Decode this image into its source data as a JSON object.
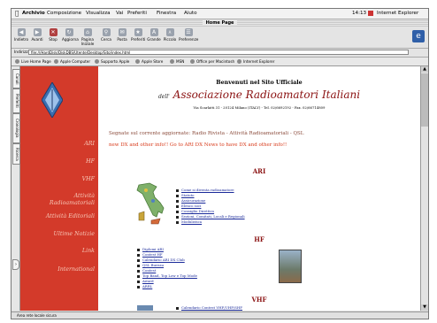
{
  "menubar": {
    "app_menu": "Archivio",
    "items": [
      "Composizione",
      "Visualizza",
      "Vai",
      "Preferiti",
      "Finestra",
      "Aiuto"
    ],
    "clock": "14:13",
    "app_name": "Internet Explorer 4.0t"
  },
  "window": {
    "title": "Home Page"
  },
  "toolbar": {
    "buttons": [
      "Indietro",
      "Avanti",
      "Stop",
      "Aggiorna",
      "Pagina Iniziale",
      "Cerca",
      "Posta",
      "Preferiti",
      "Grande",
      "Piccolo",
      "Preferenze"
    ]
  },
  "address": {
    "label": "Indirizzo:",
    "value": "file:///HardDisk/DiskDBS/Utente/Desktop/Sito/index.html"
  },
  "favorites": [
    "Live Home Page",
    "Apple Computer",
    "Supporto Apple",
    "Apple Store",
    "MSN",
    "Office per Macintosh",
    "Internet Explorer"
  ],
  "sidetabs": [
    "Canali",
    "Preferiti",
    "Cronologia",
    "Ricerca"
  ],
  "nav": {
    "items": [
      "ARI",
      "HF",
      "VHF",
      "Attività Radioamatoriali",
      "Attività Editoriali",
      "Ultime Notizie",
      "Link",
      "International"
    ]
  },
  "content": {
    "welcome": "Benvenuti nel Sito Ufficiale",
    "org_prefix": "dell'",
    "org_name": "Associazione Radioamatori Italiani",
    "address": "Via Scarlatti 31 - 20124 Milano (ITALY) - Tel. 02/6692192 - Fax. 02/66714809",
    "line1": "Segnate sul corrente aggiornate: Radio Rivista - Attività Radioamatoriali - QSL",
    "line2": "new DX and other info!! Go to ARI DX News to have DX and other info!!",
    "sections": {
      "ari": {
        "title": "ARI",
        "links": [
          "Come si diventa radioamatore",
          "Statuto",
          "Assicurazione",
          "Elenco soci",
          "Consiglio Direttivo",
          "Sezioni, Comitati, Locali e Regionali",
          "Modulistica"
        ]
      },
      "hf": {
        "title": "HF",
        "links": [
          "Diplomi ARI",
          "Contest HF",
          "Calendario ARI DX Club",
          "QSL Bureau",
          "Contest",
          "Top Band, Top Low e Top Mode",
          "Award",
          "ARRL"
        ]
      },
      "vhf": {
        "title": "VHF",
        "links": [
          "Calendario Contest VHF/UHF/SHF"
        ]
      }
    }
  },
  "statusbar": {
    "text": "Area rete locale sicura"
  },
  "colors": {
    "nav_bg": "#d33a2a",
    "nav_text": "#f7c8b8",
    "org_name": "#8a1010",
    "link": "#1a2a9a"
  }
}
